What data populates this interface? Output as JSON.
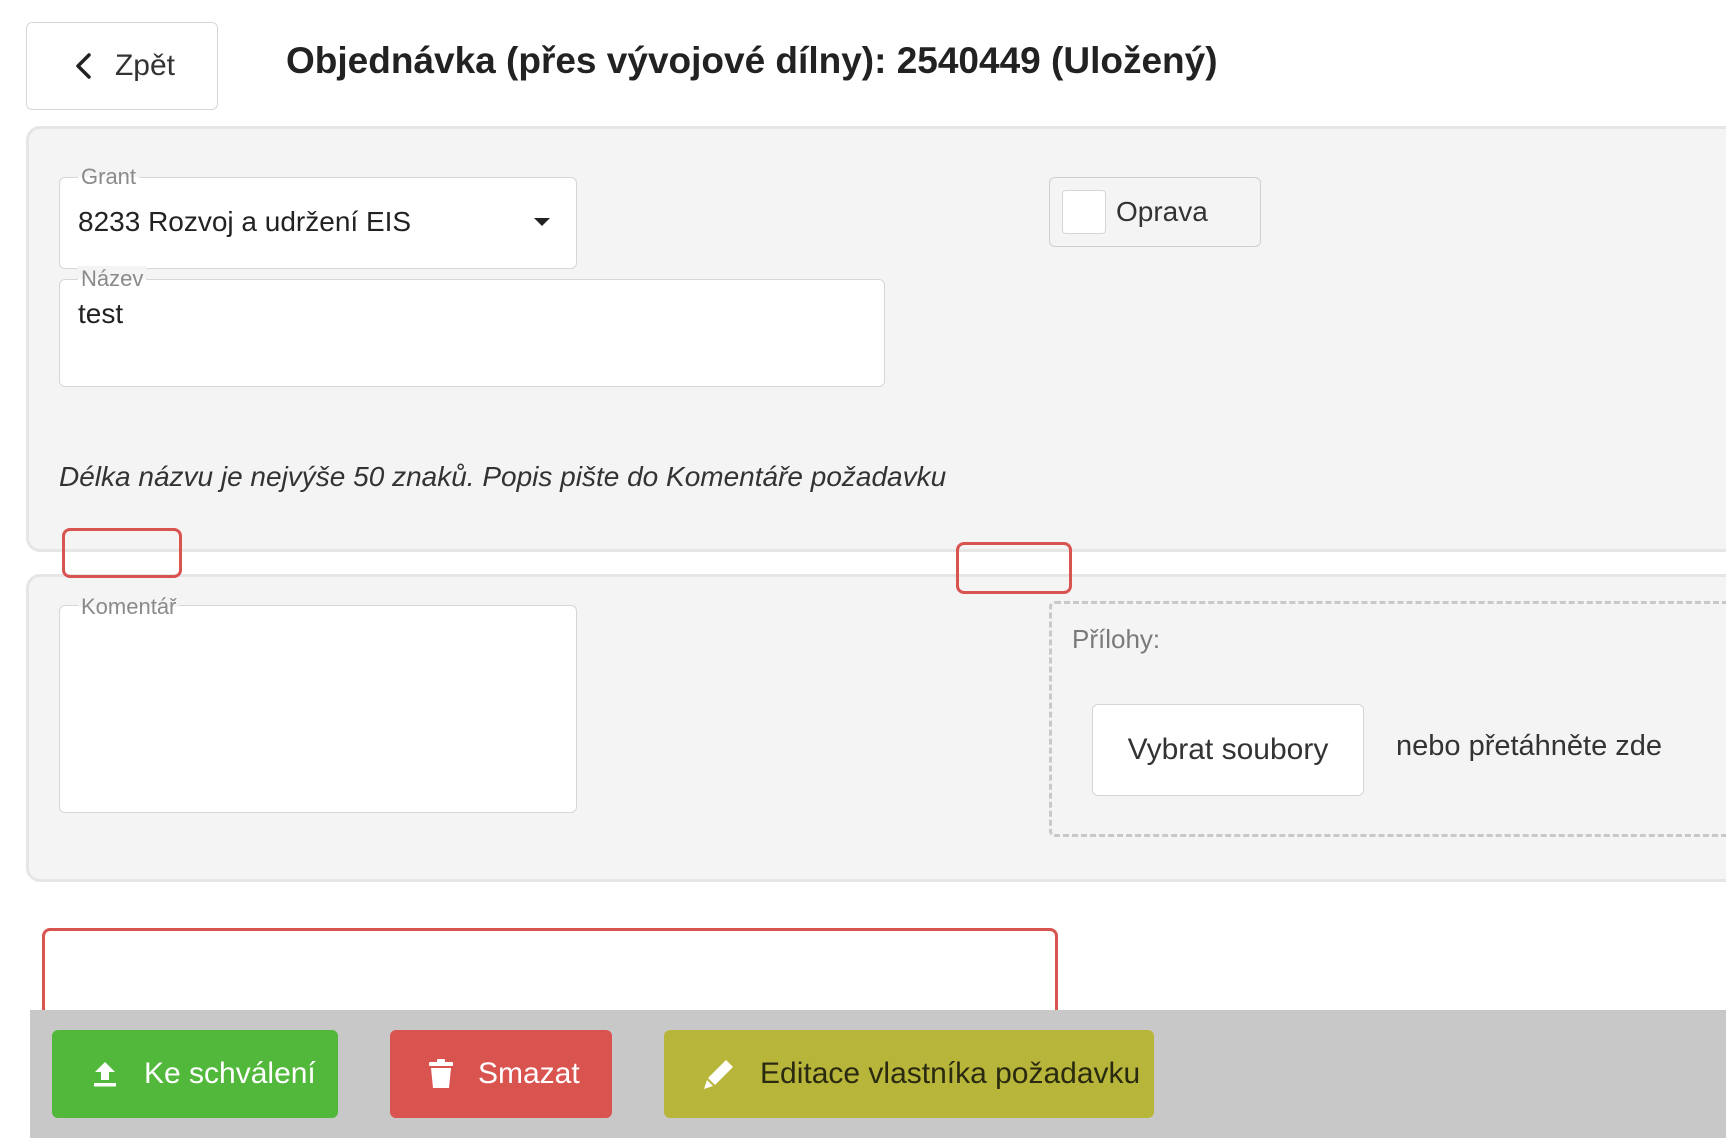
{
  "header": {
    "back_label": "Zpět",
    "title": "Objednávka (přes vývojové dílny): 2540449 (Uložený)"
  },
  "form": {
    "grant": {
      "label": "Grant",
      "value": "8233 Rozvoj a udržení EIS",
      "icon": "caret-down-icon"
    },
    "name": {
      "label": "Název",
      "value": "test"
    },
    "oprava": {
      "label": "Oprava",
      "checked": false
    },
    "hint": "Délka názvu je nejvýše 50 znaků. Popis pište do Komentáře požadavku"
  },
  "comments": {
    "comment_label": "Komentář",
    "comment_value": "",
    "attachments_label": "Přílohy:",
    "select_files_label": "Vybrat soubory",
    "drop_text": "nebo přetáhněte zde"
  },
  "actions": {
    "approve_label": "Ke schválení",
    "delete_label": "Smazat",
    "edit_owner_label": "Editace vlastníka požadavku"
  },
  "colors": {
    "approve": "#52b83c",
    "delete": "#d9534f",
    "edit_owner": "#b8b63a",
    "annotation": "#d9534f"
  }
}
